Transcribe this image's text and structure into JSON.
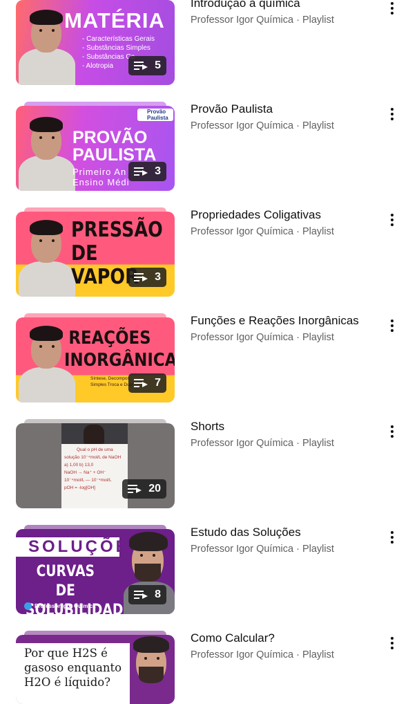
{
  "playlists": [
    {
      "title": "Introdução à química",
      "channel": "Professor Igor Química · Playlist",
      "video_count": "5",
      "thumb_heading": "MATÉRIA",
      "thumb_lines": [
        "- Características Gerais",
        "- Substâncias Simples",
        "- Substâncias Co",
        "- Alotropia"
      ],
      "thumb_color": "#a44de0"
    },
    {
      "title": "Provão Paulista",
      "channel": "Professor Igor Química · Playlist",
      "video_count": "3",
      "thumb_heading_1": "PROVÃO",
      "thumb_heading_2": "PAULISTA",
      "thumb_lines": [
        "Primeiro An",
        "Ensino Médi"
      ],
      "thumb_logo": "Provão Paulista",
      "thumb_color": "#b44ee6"
    },
    {
      "title": "Propriedades Coligativas",
      "channel": "Professor Igor Química · Playlist",
      "video_count": "3",
      "thumb_heading_1": "PRESSÃO",
      "thumb_heading_2": "DE VAPOR",
      "thumb_color": "#ff5a7e"
    },
    {
      "title": "Funções e Reações Inorgânicas",
      "channel": "Professor Igor Química · Playlist",
      "video_count": "7",
      "thumb_heading_1": "REAÇÕES",
      "thumb_heading_2": "INORGÂNICAS",
      "thumb_lines": [
        "Síntese, Decompos",
        "Simples Troca e Dupl"
      ],
      "thumb_color": "#ff5a7e"
    },
    {
      "title": "Shorts",
      "channel": "Professor Igor Química · Playlist",
      "video_count": "20",
      "thumb_lines": [
        "Qual o pH de uma",
        "solução 10⁻⁴mol/L de NaOH",
        "a) 1,00     b) 13,0",
        "NaOH → Na⁺ + OH⁻",
        "10⁻⁴mol/L — 10⁻⁴mol/L",
        "pOH = -log[OH]"
      ],
      "thumb_color": "#757170"
    },
    {
      "title": "Estudo das Soluções",
      "channel": "Professor Igor Química · Playlist",
      "video_count": "8",
      "thumb_heading_1": "SOLUÇÕES",
      "thumb_heading_2": "CURVAS DE",
      "thumb_heading_3": "SOLUBILIDADE",
      "thumb_footer": "Professor Igor Química",
      "thumb_color": "#6d1f8a"
    },
    {
      "title": "Como Calcular?",
      "channel": "Professor Igor Química · Playlist",
      "thumb_lines": [
        "Por que H2S é",
        "gasoso enquanto",
        "H2O é líquido?"
      ],
      "thumb_color": "#7a2a8c"
    }
  ],
  "icons": {
    "queue": "playlist-queue-icon",
    "more": "more-vertical-icon"
  }
}
